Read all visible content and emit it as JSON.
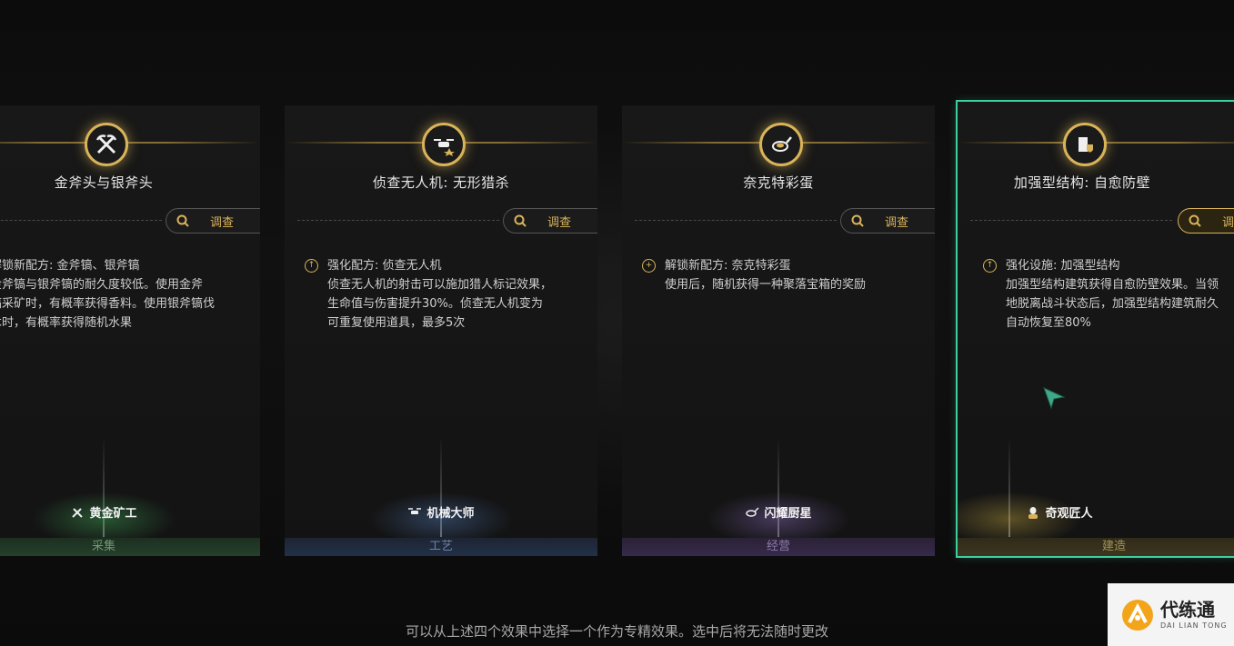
{
  "cards": [
    {
      "title": "金斧头与银斧头",
      "investigate": "调查",
      "effect_head": "解锁新配方: 金斧镐、银斧镐",
      "effect_body": "金斧镐与银斧镐的耐久度较低。使用金斧\n镐采矿时，有概率获得香料。使用银斧镐伐\n木时，有概率获得随机水果",
      "role": "黄金矿工",
      "category": "采集",
      "accent": "#4fcf6a"
    },
    {
      "title": "侦查无人机: 无形猎杀",
      "investigate": "调查",
      "effect_head": "强化配方: 侦查无人机",
      "effect_body": "侦查无人机的射击可以施加猎人标记效果，\n生命值与伤害提升30%。侦查无人机变为\n可重复使用道具，最多5次",
      "role": "机械大师",
      "category": "工艺",
      "accent": "#5f8fd8"
    },
    {
      "title": "奈克特彩蛋",
      "investigate": "调查",
      "effect_head": "解锁新配方: 奈克特彩蛋",
      "effect_body": "使用后，随机获得一种聚落宝箱的奖励",
      "role": "闪耀厨星",
      "category": "经营",
      "accent": "#a27fe0"
    },
    {
      "title": "加强型结构: 自愈防壁",
      "investigate": "调查",
      "effect_head": "强化设施: 加强型结构",
      "effect_body": "加强型结构建筑获得自愈防壁效果。当领\n地脱离战斗状态后，加强型结构建筑耐久\n自动恢复至80%",
      "role": "奇观匠人",
      "category": "建造",
      "accent": "#e1c04a"
    }
  ],
  "footer": "可以从上述四个效果中选择一个作为专精效果。选中后将无法随时更改",
  "logo": {
    "main": "代练通",
    "sub": "DAI LIAN TONG"
  },
  "colors": {
    "gold": "#d9b35a",
    "selected": "#3fcf9e"
  }
}
